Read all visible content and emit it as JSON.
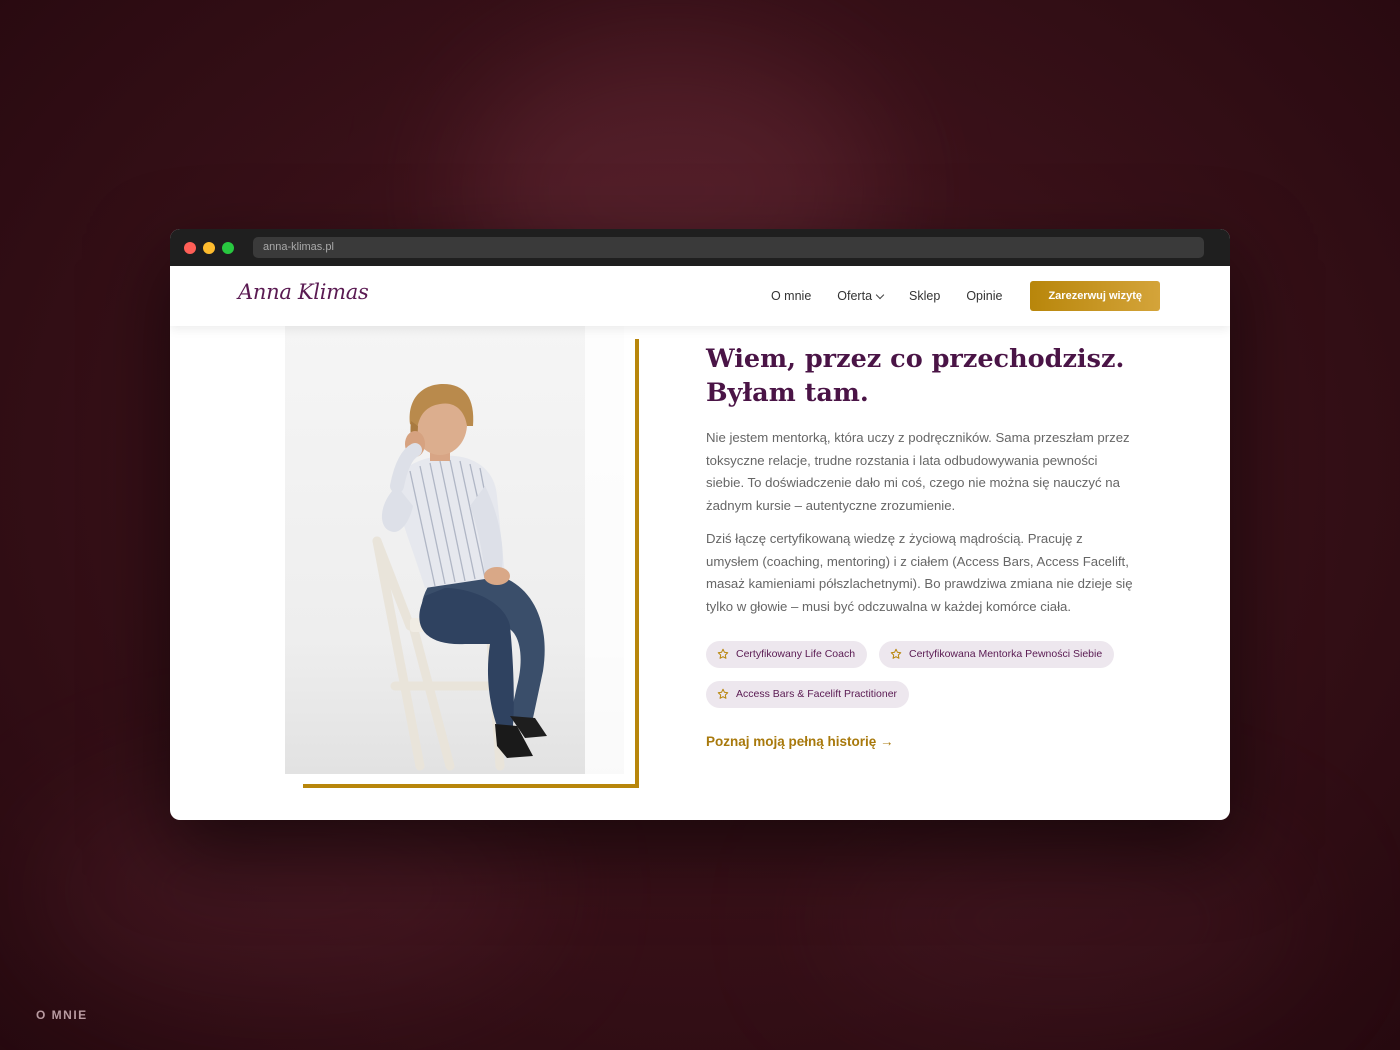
{
  "browser": {
    "url": "anna-klimas.pl"
  },
  "header": {
    "logo": "Anna Klimas",
    "nav": {
      "about": "O mnie",
      "offer": "Oferta",
      "shop": "Sklep",
      "reviews": "Opinie"
    },
    "cta": "Zarezerwuj wizytę"
  },
  "about": {
    "headline_line1": "Wiem, przez co przechodzisz.",
    "headline_line2": "Byłam tam.",
    "paragraph1": "Nie jestem mentorką, która uczy z podręczników. Sama przeszłam przez toksyczne relacje, trudne rozstania i lata odbudowywania pewności siebie. To doświadczenie dało mi coś, czego nie można się nauczyć na żadnym kursie – autentyczne zrozumienie.",
    "paragraph2": "Dziś łączę certyfikowaną wiedzę z życiową mądrością. Pracuję z umysłem (coaching, mentoring) i z ciałem (Access Bars, Access Facelift, masaż kamieniami półszlachetnymi). Bo prawdziwa zmiana nie dzieje się tylko w głowie – musi być odczuwalna w każdej komórce ciała.",
    "badges": [
      "Certyfikowany Life Coach",
      "Certyfikowana Mentorka Pewności Siebie",
      "Access Bars & Facelift Practitioner"
    ],
    "badge_icon": "star-icon",
    "story_link": "Poznaj moją pełną historię →"
  },
  "section_caption": "O MNIE",
  "colors": {
    "accent_gold": "#b8860b",
    "heading_plum": "#4a1446",
    "badge_bg": "#ede7ee",
    "background": "#3a1119"
  }
}
